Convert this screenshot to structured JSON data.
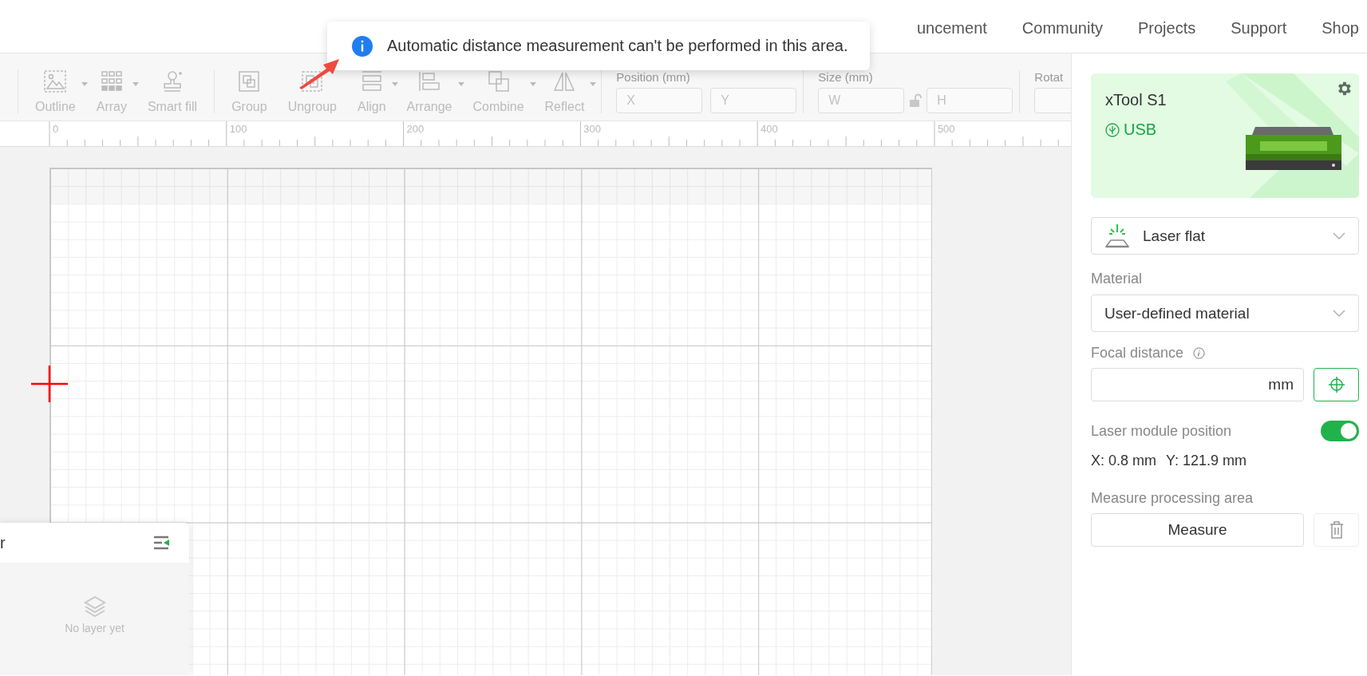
{
  "nav": {
    "items": [
      "uncement",
      "Community",
      "Projects",
      "Support",
      "Shop"
    ]
  },
  "toast": {
    "message": "Automatic distance measurement can't be performed in this area."
  },
  "toolbar": {
    "items": [
      {
        "kind": "outline",
        "label": "Outline",
        "disabled": true,
        "menu": true
      },
      {
        "kind": "array",
        "label": "Array",
        "disabled": true,
        "menu": true
      },
      {
        "kind": "smartfill",
        "label": "Smart fill",
        "disabled": true,
        "menu": false
      },
      {
        "kind": "group",
        "label": "Group",
        "disabled": true,
        "menu": false
      },
      {
        "kind": "ungroup",
        "label": "Ungroup",
        "disabled": true,
        "menu": false
      },
      {
        "kind": "align",
        "label": "Align",
        "disabled": true,
        "menu": true
      },
      {
        "kind": "arrange",
        "label": "Arrange",
        "disabled": true,
        "menu": true
      },
      {
        "kind": "combine",
        "label": "Combine",
        "disabled": true,
        "menu": true
      },
      {
        "kind": "reflect",
        "label": "Reflect",
        "disabled": true,
        "menu": true
      }
    ],
    "position": {
      "label": "Position (mm)",
      "fields": [
        {
          "placeholder": "X"
        },
        {
          "placeholder": "Y"
        }
      ]
    },
    "size": {
      "label": "Size (mm)",
      "fields": [
        {
          "placeholder": "W"
        },
        {
          "placeholder": "H"
        }
      ],
      "locked": false
    },
    "rotate": {
      "label": "Rotat"
    }
  },
  "ruler": {
    "labels": [
      "0",
      "100",
      "200",
      "300",
      "400",
      "500"
    ]
  },
  "layer_panel": {
    "title": "r",
    "empty_text": "No layer yet"
  },
  "device": {
    "name": "xTool S1",
    "connection": "USB"
  },
  "mode_select": {
    "value": "Laser flat"
  },
  "material": {
    "label": "Material",
    "value": "User-defined material"
  },
  "focal": {
    "label": "Focal distance",
    "unit": "mm"
  },
  "laser_position": {
    "label": "Laser module position",
    "on": true,
    "readings": [
      "X: 0.8 mm",
      "Y: 121.9 mm"
    ]
  },
  "measure": {
    "label": "Measure processing area",
    "button": "Measure"
  }
}
